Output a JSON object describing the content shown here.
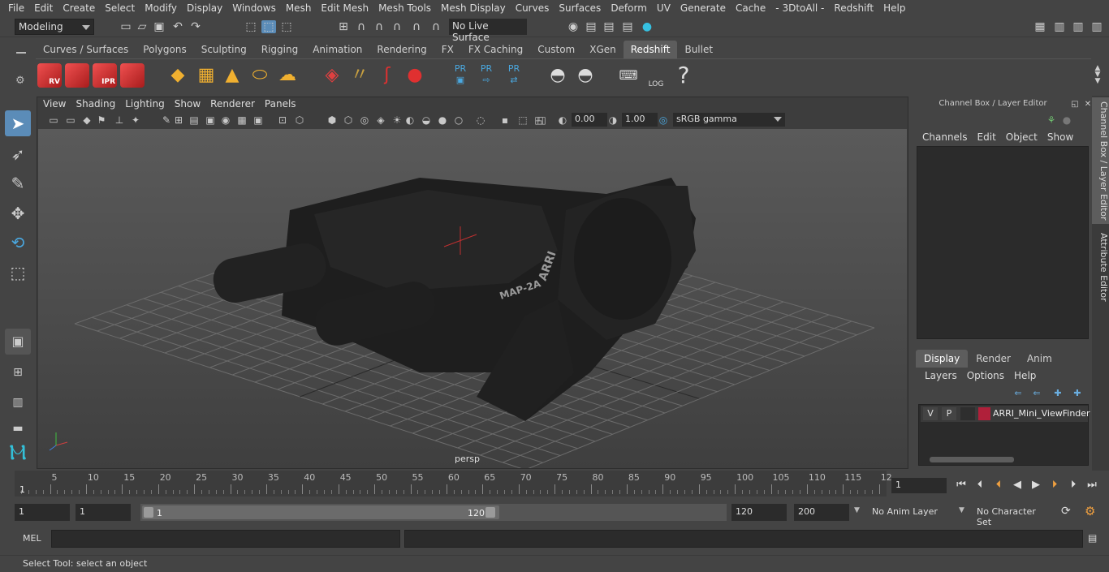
{
  "menubar": [
    "File",
    "Edit",
    "Create",
    "Select",
    "Modify",
    "Display",
    "Windows",
    "Mesh",
    "Edit Mesh",
    "Mesh Tools",
    "Mesh Display",
    "Curves",
    "Surfaces",
    "Deform",
    "UV",
    "Generate",
    "Cache",
    "- 3DtoAll -",
    "Redshift",
    "Help"
  ],
  "statusline": {
    "mode": "Modeling",
    "live_surface": "No Live Surface"
  },
  "shelf": {
    "tabs": [
      "Curves / Surfaces",
      "Polygons",
      "Sculpting",
      "Rigging",
      "Animation",
      "Rendering",
      "FX",
      "FX Caching",
      "Custom",
      "XGen",
      "Redshift",
      "Bullet"
    ],
    "active_tab": "Redshift",
    "rs_labels": [
      "RV",
      "",
      "IPR",
      ""
    ],
    "pr_labels": [
      "PR",
      "PR",
      "PR"
    ],
    "log_label": "LOG",
    "help_glyph": "?"
  },
  "viewport": {
    "menu": [
      "View",
      "Shading",
      "Lighting",
      "Show",
      "Renderer",
      "Panels"
    ],
    "exposure": "0.00",
    "gamma_value": "1.00",
    "color_space": "sRGB gamma",
    "camera": "persp",
    "model_text_1": "MAP-2A",
    "model_text_2": "ARRI"
  },
  "channel_box": {
    "title": "Channel Box / Layer Editor",
    "menu": [
      "Channels",
      "Edit",
      "Object",
      "Show"
    ]
  },
  "layer_editor": {
    "tabs": [
      "Display",
      "Render",
      "Anim"
    ],
    "active_tab": "Display",
    "menu": [
      "Layers",
      "Options",
      "Help"
    ],
    "layers": [
      {
        "v": "V",
        "p": "P",
        "color": "#b0203a",
        "name": "ARRI_Mini_ViewFinder"
      }
    ]
  },
  "side_tabs": [
    "Channel Box / Layer Editor",
    "Attribute Editor"
  ],
  "timeline": {
    "labels": [
      "5",
      "10",
      "15",
      "20",
      "25",
      "30",
      "35",
      "40",
      "45",
      "50",
      "55",
      "60",
      "65",
      "70",
      "75",
      "80",
      "85",
      "90",
      "95",
      "100",
      "105",
      "110",
      "115",
      "12"
    ],
    "current_marker": "1",
    "current_frame": "1"
  },
  "range": {
    "start": "1",
    "playback_start": "1",
    "slider_start": "1",
    "slider_end": "120",
    "playback_end": "120",
    "end": "200",
    "anim_layer": "No Anim Layer",
    "character_set": "No Character Set"
  },
  "command_line": {
    "label": "MEL"
  },
  "help_line": {
    "text": "Select Tool: select an object"
  }
}
